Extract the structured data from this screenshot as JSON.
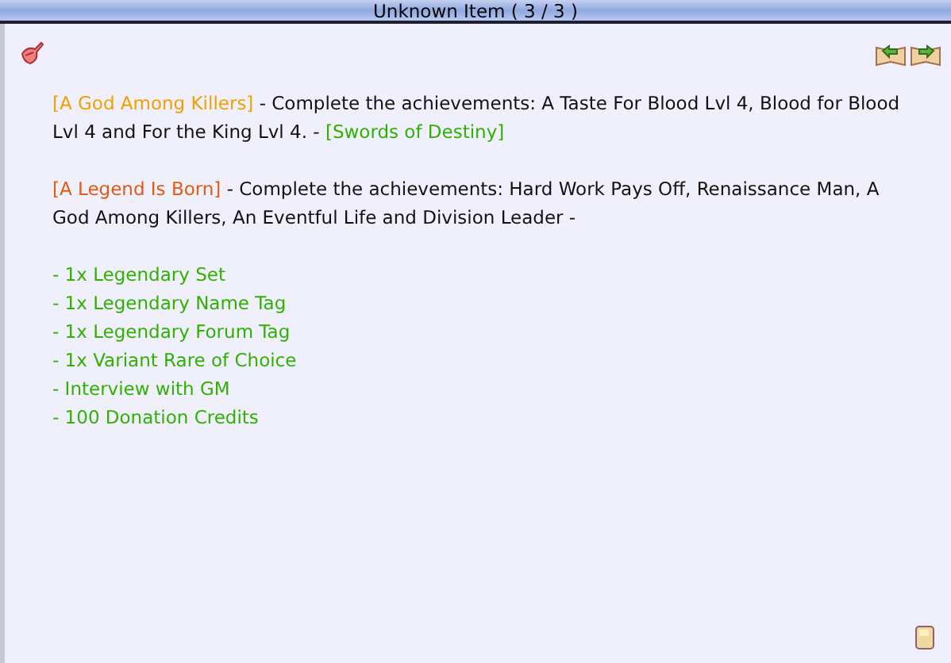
{
  "window": {
    "title": "Unknown Item ( 3 / 3 )"
  },
  "paragraphs": [
    {
      "segments": [
        {
          "kind": "achievement",
          "text": "[A God Among Killers]",
          "color": "#f0a000"
        },
        {
          "kind": "plain",
          "text": " - Complete the achievements: A Taste For Blood Lvl 4, Blood for Blood Lvl 4 and For the King Lvl 4. - "
        },
        {
          "kind": "reward",
          "text": "[Swords of Destiny]",
          "color": "#30b000"
        }
      ]
    },
    {
      "segments": [
        {
          "kind": "achievement",
          "text": "[A Legend Is Born]",
          "color": "#e05a10"
        },
        {
          "kind": "plain",
          "text": " - Complete the achievements: Hard Work Pays Off, Renaissance Man, A God Among Killers, An Eventful Life and Division Leader -"
        }
      ]
    }
  ],
  "rewards": [
    "- 1x Legendary Set",
    "- 1x Legendary Name Tag",
    "- 1x Legendary Forum Tag",
    "- 1x Variant Rare of Choice",
    "- Interview with GM",
    "- 100 Donation Credits"
  ]
}
